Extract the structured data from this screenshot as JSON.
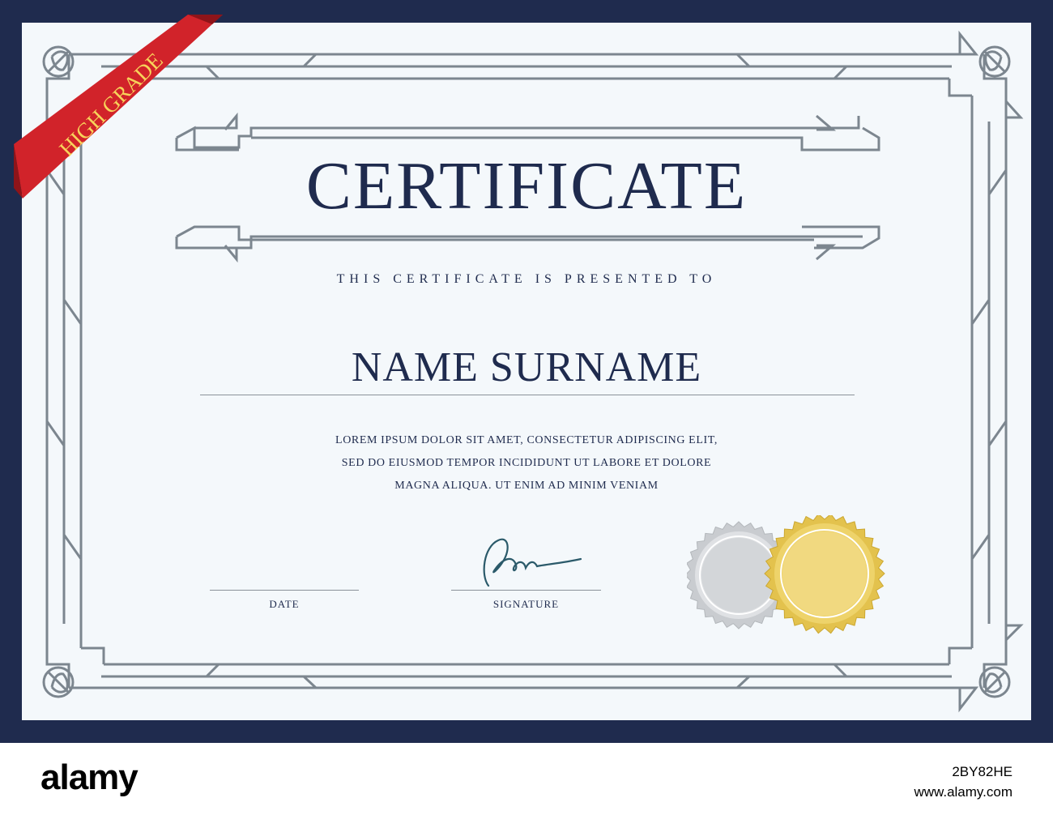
{
  "certificate": {
    "ribbon_label": "HIGH GRADE",
    "title": "CERTIFICATE",
    "presented_text": "THIS CERTIFICATE IS PRESENTED TO",
    "recipient_name": "NAME SURNAME",
    "body_lines": [
      "LOREM IPSUM DOLOR SIT AMET, CONSECTETUR ADIPISCING ELIT,",
      "SED DO EIUSMOD TEMPOR INCIDIDUNT UT LABORE ET DOLORE",
      "MAGNA ALIQUA. UT ENIM AD MINIM VENIAM"
    ],
    "date_label": "DATE",
    "signature_label": "SIGNATURE",
    "seals": [
      "silver-seal",
      "gold-seal"
    ]
  },
  "footer": {
    "brand": "alamy",
    "image_id": "2BY82HE",
    "site": "www.alamy.com"
  },
  "colors": {
    "navy": "#1f2b4e",
    "paper": "#f4f8fb",
    "frame_line": "#7c868f",
    "ribbon_red": "#d1232a",
    "ribbon_text": "#f7d35a",
    "gold": "#e3c24d",
    "silver": "#c9ccd0"
  }
}
